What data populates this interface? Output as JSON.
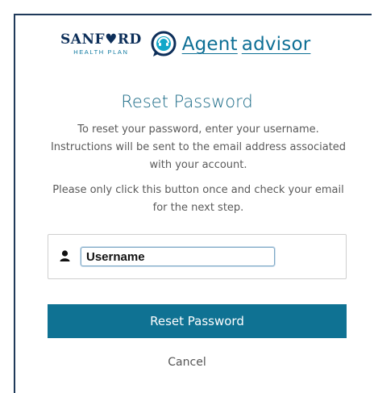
{
  "brand": {
    "sanford_word": "SANF♥RD",
    "sanford_sub": "HEALTH PLAN",
    "product_first": "Agent",
    "product_second": "advisor",
    "colors": {
      "navy": "#0d2f5a",
      "teal": "#0e6f95",
      "button": "#0f7293"
    }
  },
  "title": "Reset Password",
  "instructions": {
    "p1": "To reset your password, enter your username. Instructions will be sent to the email address associated with your account.",
    "p2": "Please only click this button once and check your email for the next step."
  },
  "form": {
    "username_value": "Username",
    "user_icon": "user-icon"
  },
  "actions": {
    "reset_label": "Reset Password",
    "cancel_label": "Cancel"
  }
}
